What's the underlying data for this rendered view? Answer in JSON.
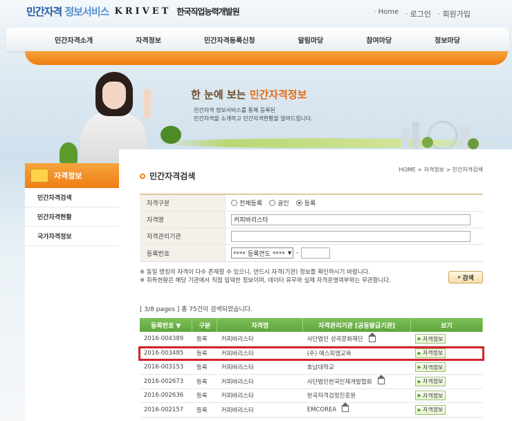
{
  "header": {
    "logo_main": "민간자격",
    "logo_sub": "정보서비스",
    "logo_krivet": "KRIVET",
    "logo_org": "한국직업능력개발원",
    "util": [
      "Home",
      "로그인",
      "회원가입"
    ]
  },
  "nav": [
    "민간자격소개",
    "자격정보",
    "민간자격등록신청",
    "알림마당",
    "참여마당",
    "정보마당"
  ],
  "hero": {
    "title_pre": "한 눈에 보는",
    "title_hl": "민간자격정보",
    "desc_line1": "민간자격 정보서비스를 통해 등록된",
    "desc_line2": "민간자격을 소개하고 민간자격현황을 알려드립니다."
  },
  "sidebar": {
    "title": "자격정보",
    "items": [
      "민간자격검색",
      "민간자격현황",
      "국가자격정보"
    ]
  },
  "page": {
    "title": "민간자격검색",
    "breadcrumb": "HOME > 자격정보 > 민간자격검색"
  },
  "search": {
    "type_label": "자격구분",
    "type_options": [
      "전체등록",
      "공인",
      "등록"
    ],
    "type_selected": "등록",
    "name_label": "자격명",
    "name_value": "커피바리스타",
    "org_label": "자격관리기관",
    "org_value": "",
    "reg_label": "등록번호",
    "reg_year": "**** 등록연도 ****",
    "reg_dash": "-",
    "reg_no": "",
    "note1": "※ 동일 명칭의 자격이 다수 존재할 수 있으니, 반드시 자격(기관) 정보를 확인하시기 바랍니다.",
    "note2": "※ 취득현황은 해당 기관에서 직접 입력한 정보이며, 데이터 유무와 실제 자격운영여부와는 무관합니다.",
    "button": "검색"
  },
  "results": {
    "count_text": "[ 3/8 pages ] 총 75건이 검색되었습니다.",
    "headers": [
      "등록번호 ▼",
      "구분",
      "자격명",
      "자격관리기관 [공동발급기관]",
      "보기"
    ],
    "view_label": "자격정보",
    "rows": [
      {
        "no": "2016-004389",
        "type": "등록",
        "name": "커피바리스타",
        "org": "사단법인 성곡문화재단",
        "home": true
      },
      {
        "no": "2016-003485",
        "type": "등록",
        "name": "커피바리스타",
        "org": "(주) 에스피엠교육",
        "home": false
      },
      {
        "no": "2016-003153",
        "type": "등록",
        "name": "커피바리스타",
        "org": "호남대학교",
        "home": false
      },
      {
        "no": "2016-002673",
        "type": "등록",
        "name": "커피바리스타",
        "org": "사단법인한국인재개발협회",
        "home": true
      },
      {
        "no": "2016-002636",
        "type": "등록",
        "name": "커피바리스타",
        "org": "한국자격검정진흥원",
        "home": false
      },
      {
        "no": "2016-002157",
        "type": "등록",
        "name": "커피바리스타",
        "org": "EMCOREA",
        "home": true
      }
    ]
  },
  "colors": {
    "accent_orange": "#ee7d15",
    "table_green": "#5da63a",
    "highlight_red": "#d2232a"
  }
}
